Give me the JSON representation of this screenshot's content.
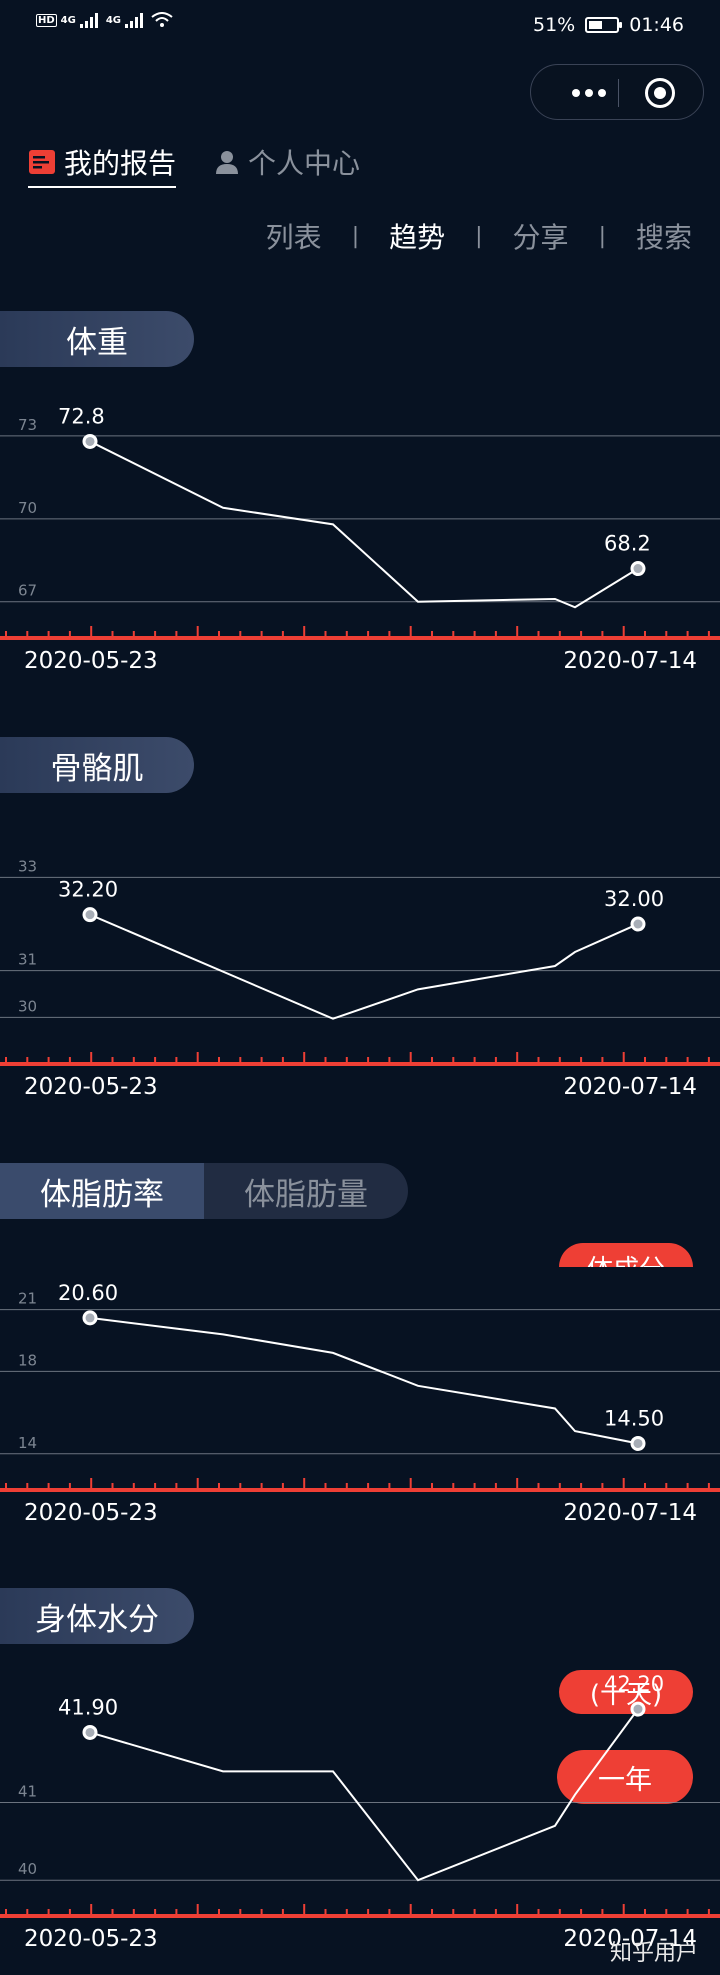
{
  "status_bar": {
    "left_tags": [
      "HD",
      "4G",
      "4G"
    ],
    "battery": "51%",
    "time": "01:46",
    "battery_level": 0.51
  },
  "capsule": {
    "more_icon": "more-dots-icon",
    "close_icon": "target-circle-icon"
  },
  "nav": {
    "tabs": [
      {
        "label": "我的报告",
        "icon": "report-icon",
        "active": true
      },
      {
        "label": "个人中心",
        "icon": "person-icon",
        "active": false
      }
    ]
  },
  "sub_nav": {
    "items": [
      {
        "label": "列表",
        "active": false
      },
      {
        "label": "趋势",
        "active": true
      },
      {
        "label": "分享",
        "active": false
      },
      {
        "label": "搜索",
        "active": false
      }
    ],
    "divider": "|"
  },
  "sections": [
    {
      "title": "体重",
      "tabs": null,
      "chart_data": {
        "type": "line",
        "yticks": [
          "73",
          "70",
          "67"
        ],
        "ytick_values": [
          73,
          70,
          67
        ],
        "ylim": [
          66.7,
          74.3
        ],
        "x_start": "2020-05-23",
        "x_end": "2020-07-14",
        "points": [
          72.8,
          70.4,
          69.8,
          67.0,
          67.1,
          66.8,
          68.2
        ],
        "first_label": "72.8",
        "last_label": "68.2"
      }
    },
    {
      "title": "骨骼肌",
      "tabs": null,
      "chart_data": {
        "type": "line",
        "yticks": [
          "33",
          "31",
          "30"
        ],
        "ytick_values": [
          33,
          31,
          30
        ],
        "ylim": [
          29.6,
          34.1
        ],
        "x_start": "2020-05-23",
        "x_end": "2020-07-14",
        "points": [
          32.2,
          29.97,
          30.6,
          31.1,
          31.4,
          32.0
        ],
        "first_label": "32.20",
        "last_label": "32.00"
      }
    },
    {
      "title": null,
      "tabs": [
        {
          "label": "体脂肪率",
          "active": true
        },
        {
          "label": "体脂肪量",
          "active": false
        }
      ],
      "pill": "体成分",
      "chart_data": {
        "type": "line",
        "yticks": [
          "21",
          "18",
          "14"
        ],
        "ytick_values": [
          21,
          18,
          14
        ],
        "ylim": [
          13.6,
          23.8
        ],
        "x_start": "2020-05-23",
        "x_end": "2020-07-14",
        "points": [
          20.6,
          19.8,
          18.9,
          17.3,
          16.2,
          15.1,
          14.5
        ],
        "first_label": "20.60",
        "last_label": "14.50"
      }
    },
    {
      "title": "身体水分",
      "tabs": null,
      "pills": [
        "(十天)",
        "一年"
      ],
      "chart_data": {
        "type": "line",
        "yticks": [
          "41",
          "40"
        ],
        "ytick_values": [
          41,
          40
        ],
        "ylim": [
          39.9,
          42.6
        ],
        "x_start": "2020-05-23",
        "x_end": "2020-07-14",
        "points": [
          41.9,
          41.4,
          41.4,
          40.0,
          40.7,
          41.1,
          42.2
        ],
        "first_label": "41.90",
        "last_label": "42.20"
      }
    }
  ],
  "watermark": "知乎用户",
  "colors": {
    "background": "#071222",
    "axis_red": "#ee3f35",
    "grid": "#8d949e",
    "line": "#ffffff",
    "tick_label": "#7c8591"
  }
}
